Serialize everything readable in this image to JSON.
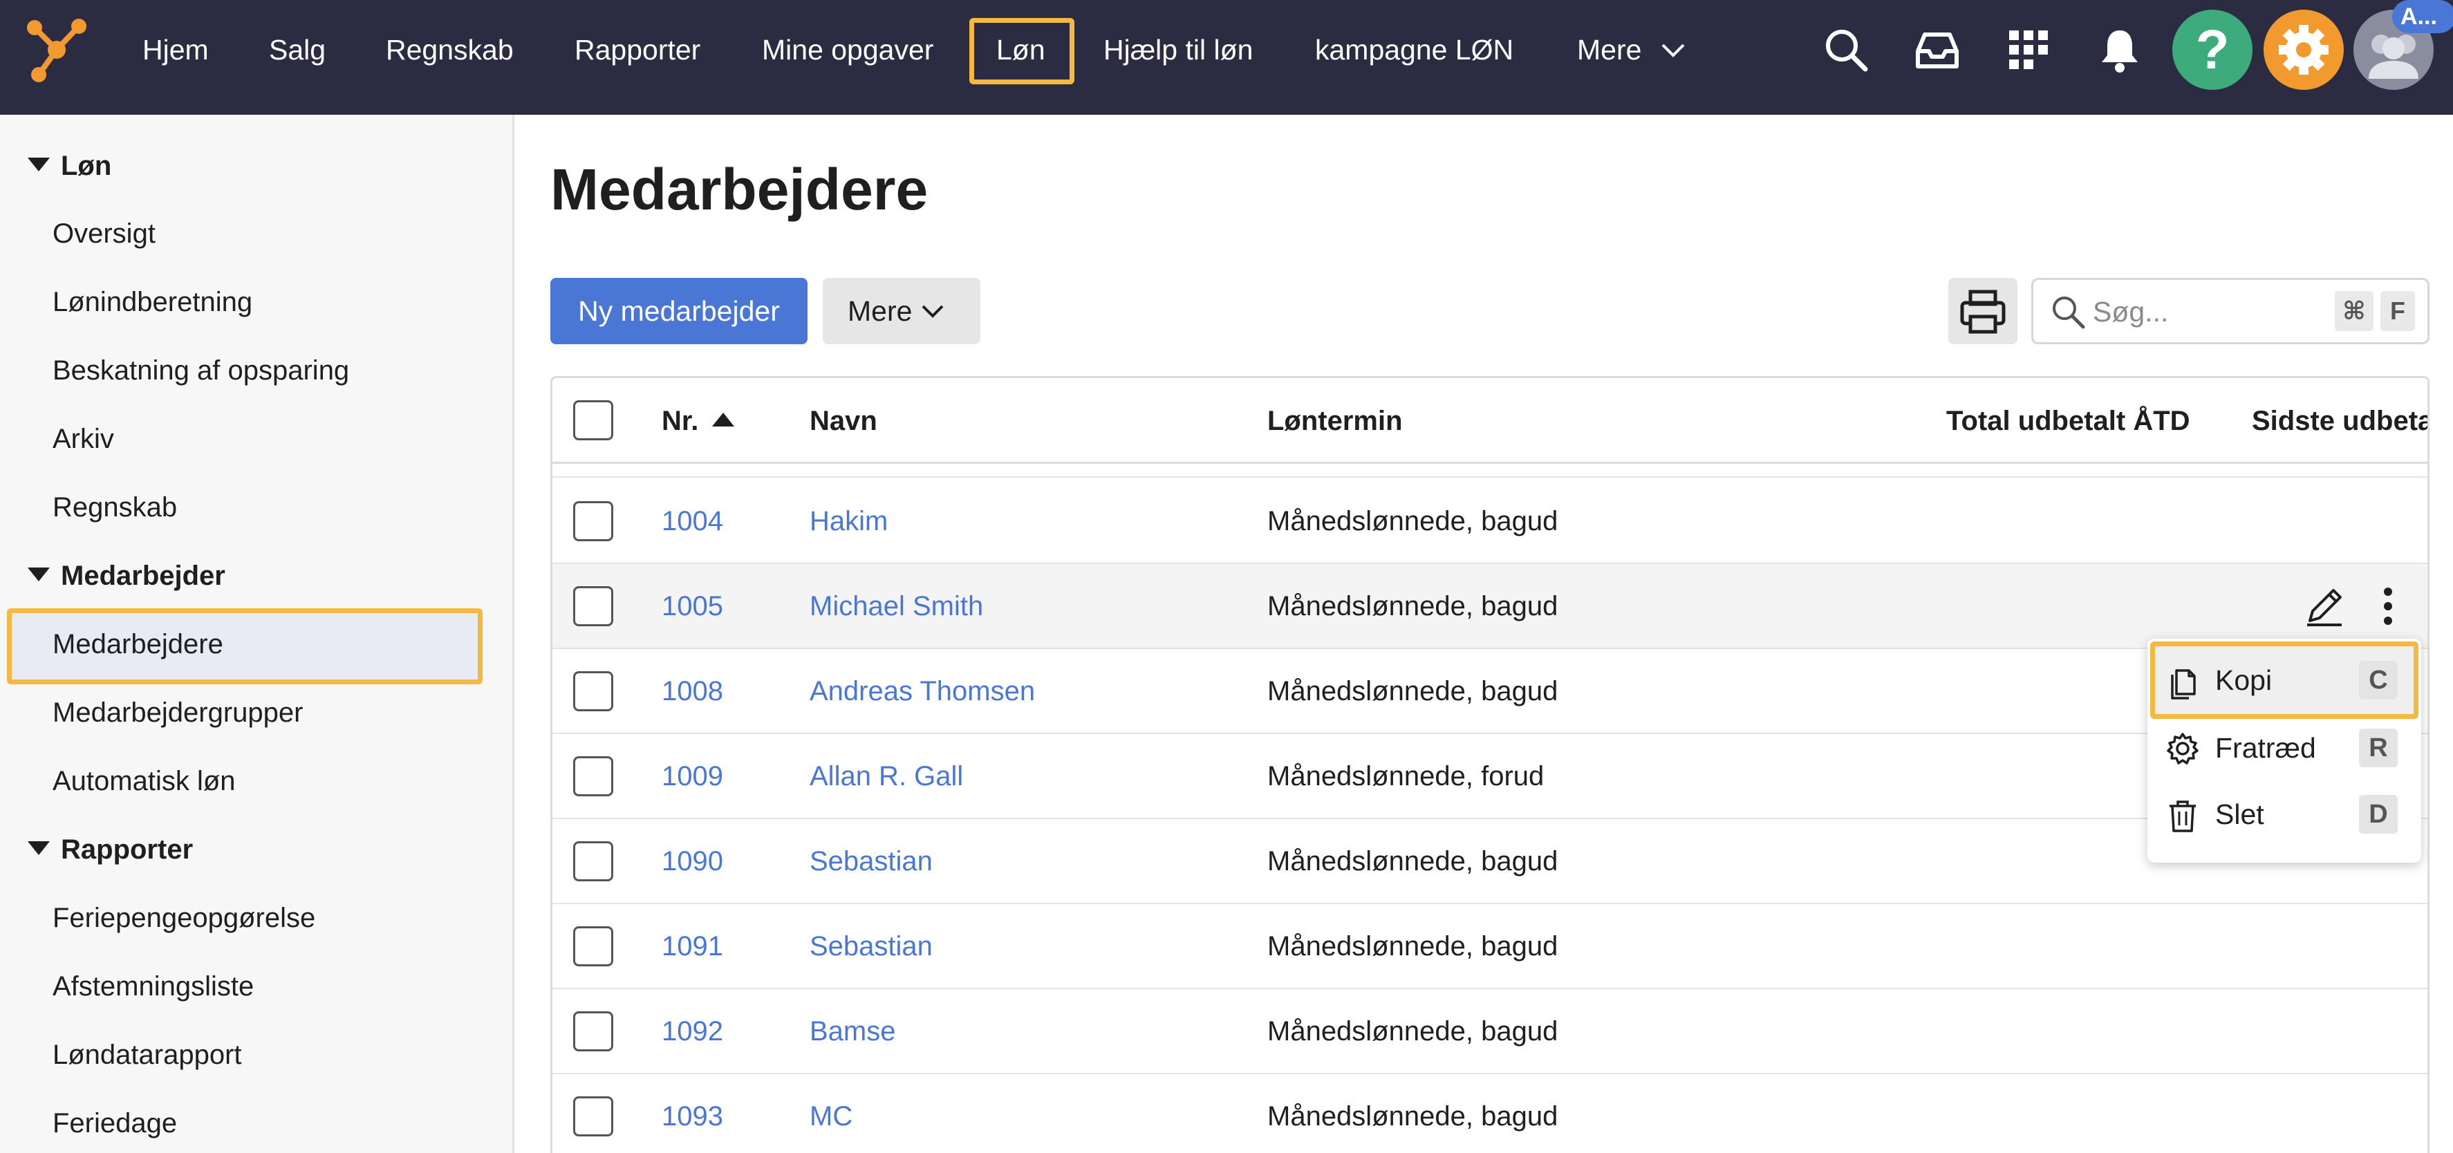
{
  "topnav": {
    "items": [
      "Hjem",
      "Salg",
      "Regnskab",
      "Rapporter",
      "Mine opgaver",
      "Løn",
      "Hjælp til løn",
      "kampagne LØN",
      "Mere"
    ],
    "active": "Løn",
    "help_glyph": "?",
    "avatar_badge": "A..."
  },
  "sidebar": {
    "sections": [
      {
        "title": "Løn",
        "items": [
          "Oversigt",
          "Lønindberetning",
          "Beskatning af opsparing",
          "Arkiv",
          "Regnskab"
        ]
      },
      {
        "title": "Medarbejder",
        "items": [
          "Medarbejdere",
          "Medarbejdergrupper",
          "Automatisk løn"
        ]
      },
      {
        "title": "Rapporter",
        "items": [
          "Feriepengeopgørelse",
          "Afstemningsliste",
          "Løndatarapport",
          "Feriedage"
        ]
      }
    ],
    "active_item": "Medarbejdere"
  },
  "main": {
    "title": "Medarbejdere",
    "new_button": "Ny medarbejder",
    "more_button": "Mere",
    "search_placeholder": "Søg...",
    "search_keys": [
      "⌘",
      "F"
    ]
  },
  "table": {
    "columns": [
      "Nr.",
      "Navn",
      "Løntermin",
      "Total udbetalt ÅTD",
      "Sidste udbetaling"
    ],
    "sort_column": "Nr.",
    "sort_direction": "ascending",
    "rows": [
      {
        "nr": "1004",
        "navn": "Hakim",
        "termin": "Månedslønnede, bagud"
      },
      {
        "nr": "1005",
        "navn": "Michael Smith",
        "termin": "Månedslønnede, bagud"
      },
      {
        "nr": "1008",
        "navn": "Andreas Thomsen",
        "termin": "Månedslønnede, bagud"
      },
      {
        "nr": "1009",
        "navn": "Allan R. Gall",
        "termin": "Månedslønnede, forud"
      },
      {
        "nr": "1090",
        "navn": "Sebastian",
        "termin": "Månedslønnede, bagud"
      },
      {
        "nr": "1091",
        "navn": "Sebastian",
        "termin": "Månedslønnede, bagud"
      },
      {
        "nr": "1092",
        "navn": "Bamse",
        "termin": "Månedslønnede, bagud"
      },
      {
        "nr": "1093",
        "navn": "MC",
        "termin": "Månedslønnede, bagud"
      }
    ],
    "hovered_row": 1
  },
  "context_menu": {
    "items": [
      {
        "label": "Kopi",
        "key": "C",
        "icon": "copy-icon"
      },
      {
        "label": "Fratræd",
        "key": "R",
        "icon": "gear-icon"
      },
      {
        "label": "Slet",
        "key": "D",
        "icon": "trash-icon"
      }
    ],
    "highlighted": 0
  },
  "colors": {
    "topbar": "#2b2c42",
    "accent_blue": "#4a77d6",
    "highlight": "#f5b942",
    "help_green": "#3dab7c",
    "settings_orange": "#f29a2e"
  }
}
